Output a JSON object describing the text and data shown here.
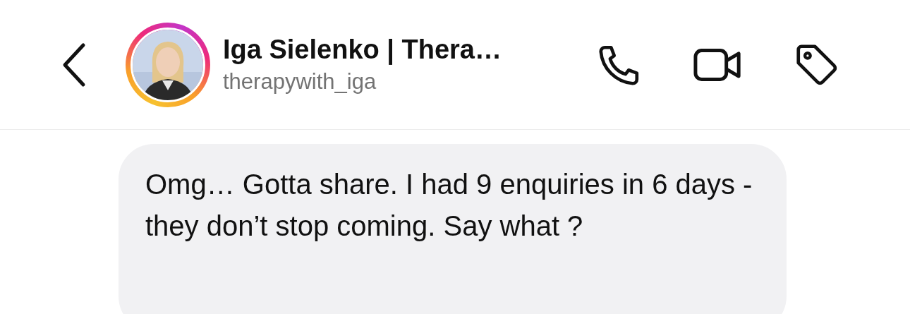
{
  "header": {
    "name": "Iga Sielenko | Thera…",
    "username": "therapywith_iga",
    "avatar": {
      "story_ring": true
    }
  },
  "messages": [
    {
      "text": "Omg… Gotta share. I had 9 enquiries in 6 days - they don’t stop coming. Say what ?",
      "from_me": false
    }
  ]
}
